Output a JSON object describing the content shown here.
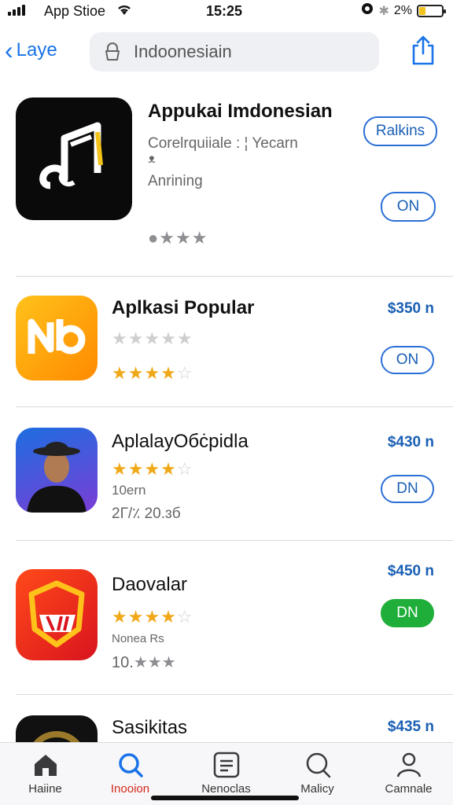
{
  "status_bar": {
    "carrier": "App Stioe",
    "time": "15:25",
    "battery_text": "2%",
    "battery_color": "#f2c31a"
  },
  "nav": {
    "back_label": "Laye",
    "search_value": "Indoonesiain",
    "search_icon": "lock-icon",
    "share_icon": "share-icon",
    "accent_color": "#1a73e8"
  },
  "featured": {
    "title": "Appukai Imdonesian",
    "subtitle_1": "Corelrquiiale : ¦ Yecarn",
    "subtitle_2": "ᴥ",
    "subtitle_3": "Anrining",
    "action_label": "Ralkins",
    "get_label": "ON",
    "rating_stars": 3
  },
  "apps": [
    {
      "title": "Aplkasi Popular",
      "price": "$350 n",
      "get_label": "ON",
      "rating_stars_top": 0,
      "rating_stars": 4
    },
    {
      "title": "AplalayOбċpidla",
      "price": "$430 n",
      "get_label": "DN",
      "rating_stars": 4,
      "line_1": "10ern",
      "line_2": "2Г/٪ 20.ɜб"
    },
    {
      "title": "Daovalar",
      "price": "$450 n",
      "get_label": "DN",
      "rating_stars": 4,
      "line_1": "Nonea Rs",
      "line_2_prefix": "10."
    },
    {
      "title": "Sasikitas",
      "price": "$435 n"
    }
  ],
  "tabs": [
    {
      "label": "Haiine",
      "icon": "house-icon",
      "active": false
    },
    {
      "label": "Inooion",
      "icon": "search-icon",
      "active": true
    },
    {
      "label": "Nenoclas",
      "icon": "list-icon",
      "active": false
    },
    {
      "label": "Malicy",
      "icon": "search-icon",
      "active": false
    },
    {
      "label": "Camnale",
      "icon": "person-icon",
      "active": false
    }
  ]
}
